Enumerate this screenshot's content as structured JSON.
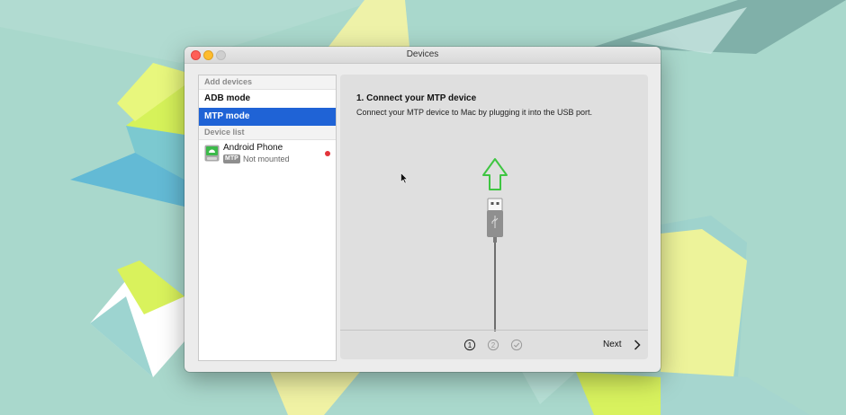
{
  "window": {
    "title": "Devices"
  },
  "sidebar": {
    "add_header": "Add devices",
    "modes": [
      {
        "label": "ADB mode",
        "selected": false
      },
      {
        "label": "MTP mode",
        "selected": true
      }
    ],
    "list_header": "Device list",
    "devices": [
      {
        "name": "Android Phone",
        "badge": "MTP",
        "status": "Not mounted",
        "status_color": "#e3343a",
        "icon": "android-phone-icon"
      }
    ]
  },
  "content": {
    "title": "1. Connect your MTP device",
    "description": "Connect your MTP device to Mac by plugging it into the USB port.",
    "steps": [
      {
        "label": "1",
        "state": "current"
      },
      {
        "label": "2",
        "state": "inactive"
      },
      {
        "label": "done",
        "state": "inactive"
      }
    ],
    "next_label": "Next"
  },
  "colors": {
    "accent": "#1f63d6",
    "arrow": "#3fc542",
    "status_red": "#e3343a"
  },
  "icons": [
    "usb-cable-icon",
    "up-arrow-icon",
    "chevron-right-icon",
    "checkmark-circle-icon"
  ]
}
